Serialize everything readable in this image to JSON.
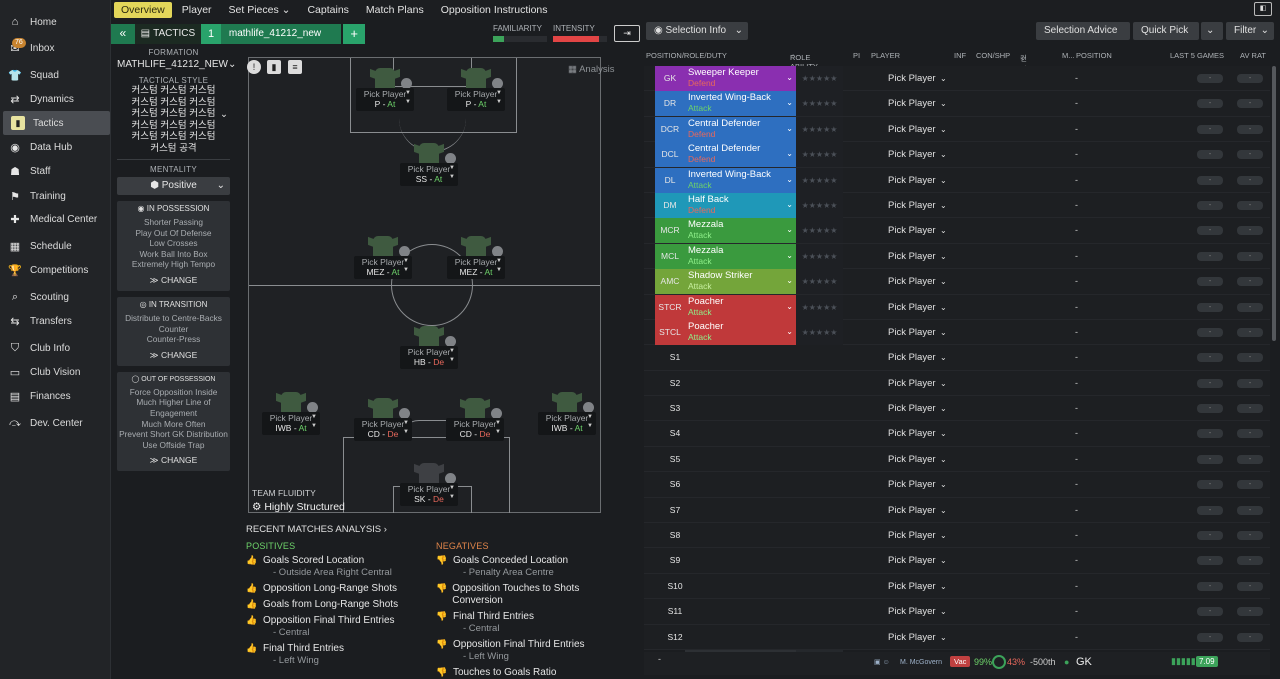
{
  "nav": [
    {
      "label": "Home",
      "icon": "home-icon",
      "glyph": "⌂"
    },
    {
      "label": "Inbox",
      "icon": "inbox-icon",
      "glyph": "✉"
    },
    {
      "label": "Squad",
      "icon": "squad-icon",
      "glyph": "👕"
    },
    {
      "label": "Dynamics",
      "icon": "dynamics-icon",
      "glyph": "⇄"
    },
    {
      "label": "Tactics",
      "icon": "tactics-icon",
      "glyph": "▮"
    },
    {
      "label": "Data Hub",
      "icon": "data-hub-icon",
      "glyph": "◉"
    },
    {
      "label": "Staff",
      "icon": "staff-icon",
      "glyph": "☗"
    },
    {
      "label": "Training",
      "icon": "training-icon",
      "glyph": "⚑"
    },
    {
      "label": "Medical Center",
      "icon": "medical-icon",
      "glyph": "✚"
    },
    {
      "label": "Schedule",
      "icon": "schedule-icon",
      "glyph": "▦"
    },
    {
      "label": "Competitions",
      "icon": "trophy-icon",
      "glyph": "🏆"
    },
    {
      "label": "Scouting",
      "icon": "scouting-icon",
      "glyph": "⌕"
    },
    {
      "label": "Transfers",
      "icon": "transfers-icon",
      "glyph": "⇆"
    },
    {
      "label": "Club Info",
      "icon": "club-info-icon",
      "glyph": "⛉"
    },
    {
      "label": "Club Vision",
      "icon": "club-vision-icon",
      "glyph": "▭"
    },
    {
      "label": "Finances",
      "icon": "finances-icon",
      "glyph": "▤"
    },
    {
      "label": "Dev. Center",
      "icon": "dev-center-icon",
      "glyph": "⤼"
    }
  ],
  "inbox_badge": "76",
  "tabs": [
    "Overview",
    "Player",
    "Set Pieces",
    "Captains",
    "Match Plans",
    "Opposition Instructions"
  ],
  "set_pieces_chevron": "⌄",
  "tactic": {
    "label": "TACTICS",
    "number": "1",
    "name": "mathlife_41212_new",
    "add": "+"
  },
  "panel": {
    "formation_label": "FORMATION",
    "formation": "MATHLIFE_41212_NEW",
    "style_label": "TACTICAL STYLE",
    "style_lines": [
      "커스텀 커스텀 커스텀",
      "커스텀 커스텀 커스텀",
      "커스텀 커스텀 커스텀",
      "커스텀 커스텀 커스텀",
      "커스텀 커스텀 커스텀",
      "커스텀 공격"
    ],
    "mentality_label": "MENTALITY",
    "mentality": "Positive",
    "in_possession": {
      "title": "IN POSSESSION",
      "items": [
        "Shorter Passing",
        "Play Out Of Defense",
        "Low Crosses",
        "Work Ball Into Box",
        "Extremely High Tempo"
      ],
      "change": "CHANGE"
    },
    "in_transition": {
      "title": "IN TRANSITION",
      "items": [
        "Distribute to Centre-Backs",
        "Counter",
        "Counter-Press"
      ],
      "change": "CHANGE"
    },
    "out_possession": {
      "title": "OUT OF POSSESSION",
      "items": [
        "Force Opposition Inside",
        "Much Higher Line of Engagement",
        "Much More Often",
        "Prevent Short GK Distribution",
        "Use Offside Trap"
      ],
      "change": "CHANGE"
    }
  },
  "familiarity": {
    "label": "FAMILIARITY",
    "value": 0.2
  },
  "intensity": {
    "label": "INTENSITY",
    "value": 0.85
  },
  "analysis_label": "Analysis",
  "fluidity": {
    "label": "TEAM FLUIDITY",
    "value": "Highly Structured"
  },
  "pitch_players": [
    {
      "id": "stcl",
      "pick": "Pick Player",
      "role": "P",
      "duty": "At",
      "cls": "at"
    },
    {
      "id": "stcr",
      "pick": "Pick Player",
      "role": "P",
      "duty": "At",
      "cls": "at"
    },
    {
      "id": "amc",
      "pick": "Pick Player",
      "role": "SS",
      "duty": "At",
      "cls": "at"
    },
    {
      "id": "mcl",
      "pick": "Pick Player",
      "role": "MEZ",
      "duty": "At",
      "cls": "at"
    },
    {
      "id": "mcr",
      "pick": "Pick Player",
      "role": "MEZ",
      "duty": "At",
      "cls": "at"
    },
    {
      "id": "dm",
      "pick": "Pick Player",
      "role": "HB",
      "duty": "De",
      "cls": "de"
    },
    {
      "id": "dl",
      "pick": "Pick Player",
      "role": "IWB",
      "duty": "At",
      "cls": "at"
    },
    {
      "id": "dcl",
      "pick": "Pick Player",
      "role": "CD",
      "duty": "De",
      "cls": "de"
    },
    {
      "id": "dcr",
      "pick": "Pick Player",
      "role": "CD",
      "duty": "De",
      "cls": "de"
    },
    {
      "id": "dr",
      "pick": "Pick Player",
      "role": "IWB",
      "duty": "At",
      "cls": "at"
    },
    {
      "id": "gk",
      "pick": "Pick Player",
      "role": "SK",
      "duty": "De",
      "cls": "de"
    }
  ],
  "recent": {
    "title": "RECENT MATCHES ANALYSIS",
    "pos_label": "POSITIVES",
    "positives": [
      {
        "t": "Goals Scored Location",
        "s": "- Outside Area Right Central"
      },
      {
        "t": "Opposition Long-Range Shots",
        "s": ""
      },
      {
        "t": "Goals from Long-Range Shots",
        "s": ""
      },
      {
        "t": "Opposition Final Third Entries",
        "s": "- Central"
      },
      {
        "t": "Final Third Entries",
        "s": "- Left Wing"
      }
    ],
    "neg_label": "NEGATIVES",
    "negatives": [
      {
        "t": "Goals Conceded Location",
        "s": "- Penalty Area Centre"
      },
      {
        "t": "Opposition Touches to Shots Conversion",
        "s": ""
      },
      {
        "t": "Final Third Entries",
        "s": "- Central"
      },
      {
        "t": "Opposition Final Third Entries",
        "s": "- Left Wing"
      },
      {
        "t": "Touches to Goals Ratio",
        "s": ""
      }
    ]
  },
  "right": {
    "selection_info": "Selection Info",
    "selection_advice": "Selection Advice",
    "quick_pick": "Quick Pick",
    "filter": "Filter",
    "headers": {
      "pos": "POSITION/ROLE/DUTY",
      "ability": "ROLE ABILITY",
      "pi": "PI",
      "player": "PLAYER",
      "inf": "INF",
      "con": "CON/SHP",
      "korean": "컨디션(N)",
      "m": "M...",
      "position": "POSITION",
      "last5": "LAST 5 GAMES",
      "avrat": "AV RAT"
    },
    "rows": [
      {
        "pos": "GK",
        "role": "Sweeper Keeper",
        "duty": "Defend",
        "color": "#8a2fb0",
        "dcol": "#e8685c"
      },
      {
        "pos": "DR",
        "role": "Inverted Wing-Back",
        "duty": "Attack",
        "color": "#2e6fc0",
        "dcol": "#6ed36a"
      },
      {
        "pos": "DCR",
        "role": "Central Defender",
        "duty": "Defend",
        "color": "#2e6fc0",
        "dcol": "#e8685c"
      },
      {
        "pos": "DCL",
        "role": "Central Defender",
        "duty": "Defend",
        "color": "#2e6fc0",
        "dcol": "#e8685c"
      },
      {
        "pos": "DL",
        "role": "Inverted Wing-Back",
        "duty": "Attack",
        "color": "#2e6fc0",
        "dcol": "#6ed36a"
      },
      {
        "pos": "DM",
        "role": "Half Back",
        "duty": "Defend",
        "color": "#1f98b8",
        "dcol": "#e8685c"
      },
      {
        "pos": "MCR",
        "role": "Mezzala",
        "duty": "Attack",
        "color": "#3a9a3e",
        "dcol": "#8ff08a"
      },
      {
        "pos": "MCL",
        "role": "Mezzala",
        "duty": "Attack",
        "color": "#3a9a3e",
        "dcol": "#8ff08a"
      },
      {
        "pos": "AMC",
        "role": "Shadow Striker",
        "duty": "Attack",
        "color": "#74a53a",
        "dcol": "#c8f0a0"
      },
      {
        "pos": "STCR",
        "role": "Poacher",
        "duty": "Attack",
        "color": "#c0393a",
        "dcol": "#8ff08a"
      },
      {
        "pos": "STCL",
        "role": "Poacher",
        "duty": "Attack",
        "color": "#c0393a",
        "dcol": "#8ff08a"
      },
      {
        "pos": "S1",
        "role": "",
        "duty": "",
        "color": "",
        "dcol": ""
      },
      {
        "pos": "S2",
        "role": "",
        "duty": "",
        "color": "",
        "dcol": ""
      },
      {
        "pos": "S3",
        "role": "",
        "duty": "",
        "color": "",
        "dcol": ""
      },
      {
        "pos": "S4",
        "role": "",
        "duty": "",
        "color": "",
        "dcol": ""
      },
      {
        "pos": "S5",
        "role": "",
        "duty": "",
        "color": "",
        "dcol": ""
      },
      {
        "pos": "S6",
        "role": "",
        "duty": "",
        "color": "",
        "dcol": ""
      },
      {
        "pos": "S7",
        "role": "",
        "duty": "",
        "color": "",
        "dcol": ""
      },
      {
        "pos": "S8",
        "role": "",
        "duty": "",
        "color": "",
        "dcol": ""
      },
      {
        "pos": "S9",
        "role": "",
        "duty": "",
        "color": "",
        "dcol": ""
      },
      {
        "pos": "S10",
        "role": "",
        "duty": "",
        "color": "",
        "dcol": ""
      },
      {
        "pos": "S11",
        "role": "",
        "duty": "",
        "color": "",
        "dcol": ""
      },
      {
        "pos": "S12",
        "role": "",
        "duty": "",
        "color": "",
        "dcol": ""
      }
    ],
    "pick": "Pick Player",
    "dash": "-",
    "stars": "★★★★★",
    "footer": {
      "pos": "-",
      "name": "M. McGovern",
      "badge": "Vac",
      "cond": "99%",
      "sharp": "43%",
      "worth": "-500th",
      "position": "GK",
      "rating": "7.09"
    }
  }
}
